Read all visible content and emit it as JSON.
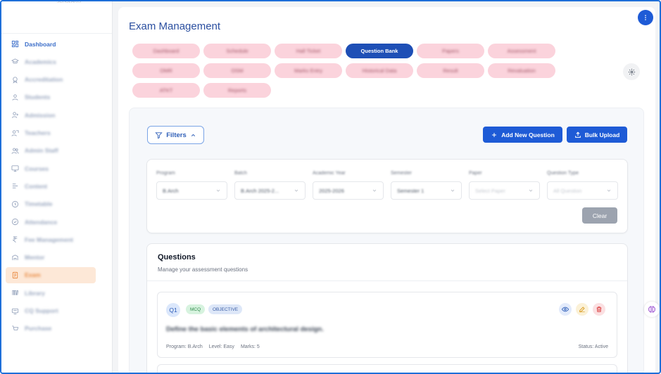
{
  "sidebar": {
    "logo_caption": "SCHOLARIS",
    "items": [
      {
        "label": "Dashboard",
        "icon": "dashboard-grid-icon"
      },
      {
        "label": "Academics",
        "icon": "graduation-cap-icon"
      },
      {
        "label": "Accreditation",
        "icon": "badge-icon"
      },
      {
        "label": "Students",
        "icon": "user-icon"
      },
      {
        "label": "Admission",
        "icon": "user-plus-icon"
      },
      {
        "label": "Teachers",
        "icon": "teacher-icon"
      },
      {
        "label": "Admin Staff",
        "icon": "users-icon"
      },
      {
        "label": "Courses",
        "icon": "monitor-icon"
      },
      {
        "label": "Content",
        "icon": "content-icon"
      },
      {
        "label": "Timetable",
        "icon": "clock-icon"
      },
      {
        "label": "Attendance",
        "icon": "attendance-icon"
      },
      {
        "label": "Fee Management",
        "icon": "rupee-icon"
      },
      {
        "label": "Mentor",
        "icon": "mentor-icon"
      },
      {
        "label": "Exam",
        "icon": "exam-doc-icon"
      },
      {
        "label": "Library",
        "icon": "library-icon"
      },
      {
        "label": "CQ Support",
        "icon": "support-icon"
      },
      {
        "label": "Purchase",
        "icon": "purchase-icon"
      }
    ],
    "active_index": 13
  },
  "header": {
    "title": "Exam Management"
  },
  "tabs": [
    {
      "label": "Dashboard"
    },
    {
      "label": "Schedule"
    },
    {
      "label": "Hall Ticket"
    },
    {
      "label": "Question Bank"
    },
    {
      "label": "Papers"
    },
    {
      "label": "Assessment"
    },
    {
      "label": "OMR"
    },
    {
      "label": "OSM"
    },
    {
      "label": "Marks Entry"
    },
    {
      "label": "Historical Data"
    },
    {
      "label": "Result"
    },
    {
      "label": "Revaluation"
    },
    {
      "label": "ATKT"
    },
    {
      "label": "Reports"
    }
  ],
  "active_tab": 3,
  "toolbar": {
    "filters_label": "Filters",
    "add_label": "Add New Question",
    "bulk_label": "Bulk Upload"
  },
  "filters": {
    "fields": [
      {
        "label": "Program",
        "value": "B.Arch",
        "placeholder": false
      },
      {
        "label": "Batch",
        "value": "B.Arch 2025-2...",
        "placeholder": false
      },
      {
        "label": "Academic Year",
        "value": "2025-2026",
        "placeholder": false
      },
      {
        "label": "Semester",
        "value": "Semester 1",
        "placeholder": false
      },
      {
        "label": "Paper",
        "value": "Select Paper",
        "placeholder": true
      },
      {
        "label": "Question Type",
        "value": "All Question",
        "placeholder": true
      }
    ],
    "clear_label": "Clear"
  },
  "questions": {
    "title": "Questions",
    "subtitle": "Manage your assessment questions",
    "items": [
      {
        "number": "Q1",
        "type": "MCQ",
        "category": "OBJECTIVE",
        "text": "Define the basic elements of architectural design.",
        "program": "Program: B.Arch",
        "level": "Level: Easy",
        "marks": "Marks: 5",
        "status": "Status: Active"
      }
    ]
  },
  "colors": {
    "accent": "#1e5bd6",
    "tab_inactive": "#fbd3dc",
    "tab_active": "#1e4fb6",
    "sidebar_active": "#fde8d7"
  }
}
